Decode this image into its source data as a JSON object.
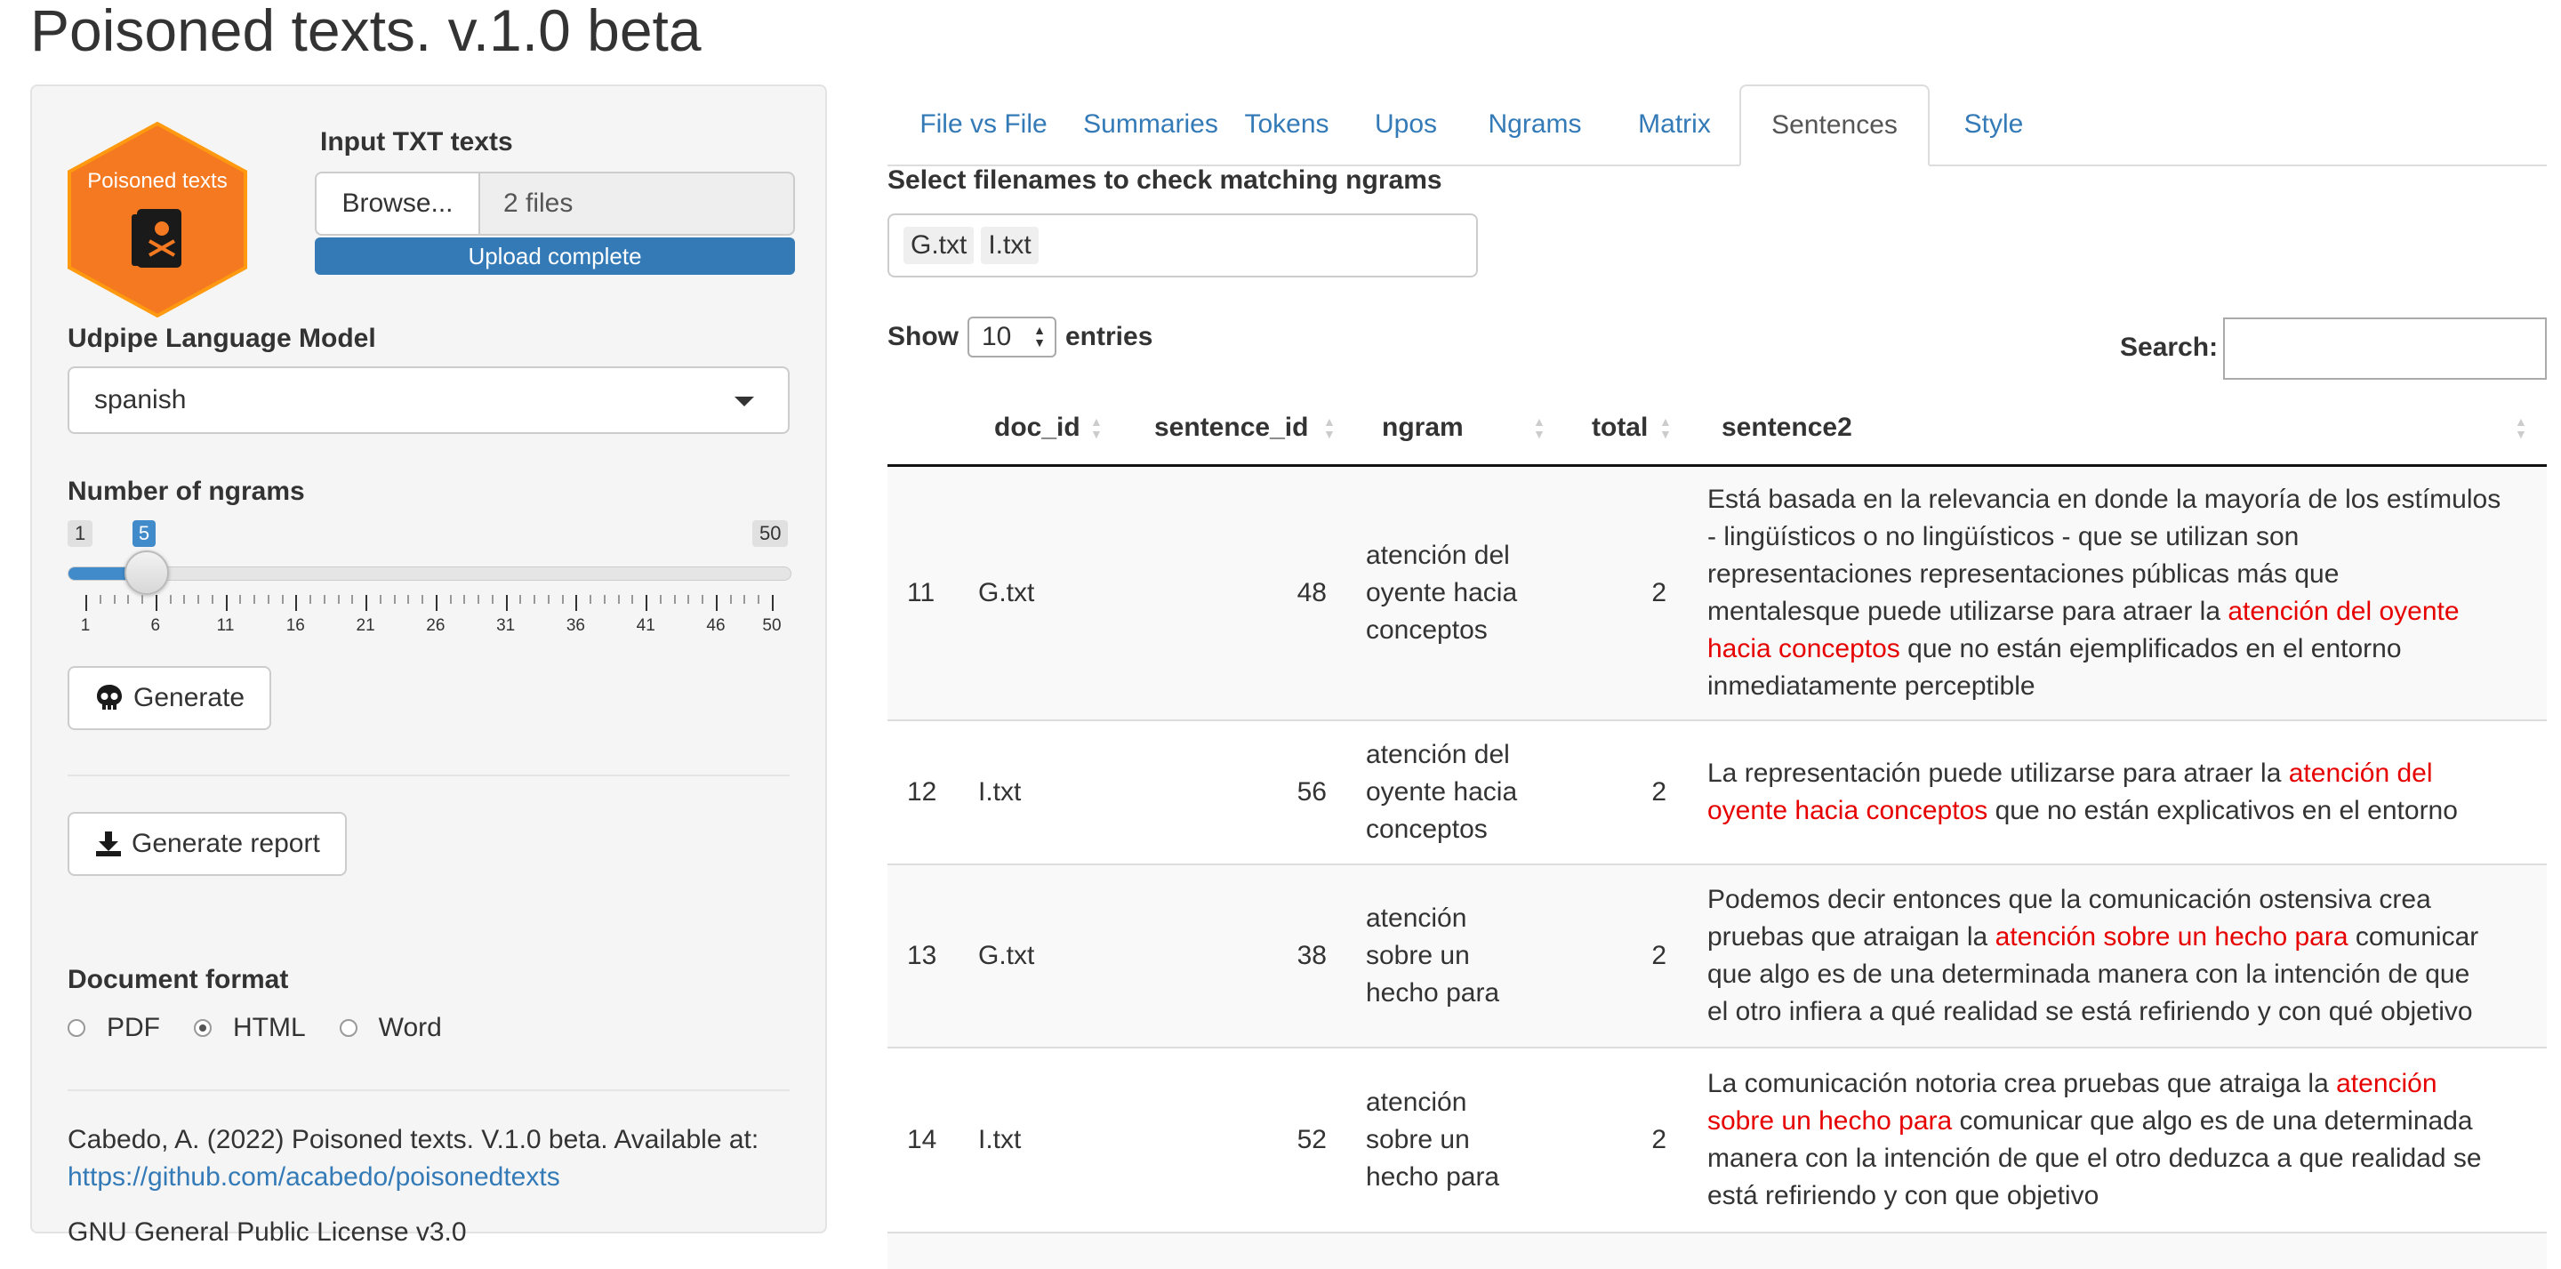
{
  "app": {
    "title": "Poisoned texts. v.1.0 beta"
  },
  "sidebar": {
    "logo_text": "Poisoned texts",
    "input_label": "Input TXT texts",
    "browse_label": "Browse...",
    "files_value": "2 files",
    "upload_status": "Upload complete",
    "upload_progress_pct": 100,
    "udpipe_label": "Udpipe Language Model",
    "udpipe_value": "spanish",
    "ngrams_label": "Number of ngrams",
    "ngrams_min": "1",
    "ngrams_max": "50",
    "ngrams_value": "5",
    "ngrams_ticks": [
      "1",
      "6",
      "11",
      "16",
      "21",
      "26",
      "31",
      "36",
      "41",
      "46",
      "50"
    ],
    "generate_label": "Generate",
    "report_label": "Generate report",
    "format_label": "Document format",
    "format_options": [
      "PDF",
      "HTML",
      "Word"
    ],
    "format_selected": "HTML",
    "citation": "Cabedo, A. (2022) Poisoned texts. V.1.0 beta. Available at:",
    "citation_link": "https://github.com/acabedo/poisonedtexts",
    "license": "GNU General Public License v3.0"
  },
  "tabs": [
    "File vs File",
    "Summaries",
    "Tokens",
    "Upos",
    "Ngrams",
    "Matrix",
    "Sentences",
    "Style"
  ],
  "active_tab": "Sentences",
  "main": {
    "select_label": "Select filenames to check matching ngrams",
    "selected_files": [
      "G.txt",
      "I.txt"
    ],
    "show_label": "Show",
    "entries_value": "10",
    "entries_label": "entries",
    "search_label": "Search:",
    "search_value": ""
  },
  "table": {
    "columns": [
      "",
      "doc_id",
      "sentence_id",
      "ngram",
      "total",
      "sentence2"
    ],
    "rows": [
      {
        "row": "11",
        "doc_id": "G.txt",
        "sentence_id": "48",
        "ngram": [
          "atención del",
          "oyente hacia",
          "conceptos"
        ],
        "total": "2",
        "sentence": [
          [
            {
              "t": "Está basada en la relevancia en donde la mayoría de los estímulos",
              "h": false
            }
          ],
          [
            {
              "t": "- lingüísticos o no lingüísticos - que se utilizan son",
              "h": false
            }
          ],
          [
            {
              "t": "representaciones representaciones públicas más que",
              "h": false
            }
          ],
          [
            {
              "t": "mentalesque puede utilizarse para atraer la ",
              "h": false
            },
            {
              "t": "atención del oyente",
              "h": true
            }
          ],
          [
            {
              "t": "hacia conceptos",
              "h": true
            },
            {
              "t": " que no están ejemplificados en el entorno",
              "h": false
            }
          ],
          [
            {
              "t": "inmediatamente perceptible",
              "h": false
            }
          ]
        ]
      },
      {
        "row": "12",
        "doc_id": "I.txt",
        "sentence_id": "56",
        "ngram": [
          "atención del",
          "oyente hacia",
          "conceptos"
        ],
        "total": "2",
        "sentence": [
          [
            {
              "t": "La representación puede utilizarse para atraer la ",
              "h": false
            },
            {
              "t": "atención del",
              "h": true
            }
          ],
          [
            {
              "t": "oyente hacia conceptos",
              "h": true
            },
            {
              "t": " que no están explicativos en el entorno",
              "h": false
            }
          ]
        ]
      },
      {
        "row": "13",
        "doc_id": "G.txt",
        "sentence_id": "38",
        "ngram": [
          "atención",
          "sobre un",
          "hecho para"
        ],
        "total": "2",
        "sentence": [
          [
            {
              "t": "Podemos decir entonces que la comunicación ostensiva crea",
              "h": false
            }
          ],
          [
            {
              "t": "pruebas que atraigan la ",
              "h": false
            },
            {
              "t": "atención sobre un hecho para",
              "h": true
            },
            {
              "t": " comunicar",
              "h": false
            }
          ],
          [
            {
              "t": "que algo es de una determinada manera con la intención de que",
              "h": false
            }
          ],
          [
            {
              "t": "el otro infiera a qué realidad se está refiriendo y con qué objetivo",
              "h": false
            }
          ]
        ]
      },
      {
        "row": "14",
        "doc_id": "I.txt",
        "sentence_id": "52",
        "ngram": [
          "atención",
          "sobre un",
          "hecho para"
        ],
        "total": "2",
        "sentence": [
          [
            {
              "t": "La comunicación notoria crea pruebas que atraiga la ",
              "h": false
            },
            {
              "t": "atención",
              "h": true
            }
          ],
          [
            {
              "t": "sobre un hecho para",
              "h": true
            },
            {
              "t": " comunicar que algo es de una determinada",
              "h": false
            }
          ],
          [
            {
              "t": "manera con la intención de que el otro deduzca a que realidad se",
              "h": false
            }
          ],
          [
            {
              "t": "está refiriendo y con que objetivo",
              "h": false
            }
          ]
        ]
      }
    ]
  },
  "colors": {
    "accent": "#337ab7",
    "highlight": "#e60000",
    "logo_orange": "#f47920"
  }
}
